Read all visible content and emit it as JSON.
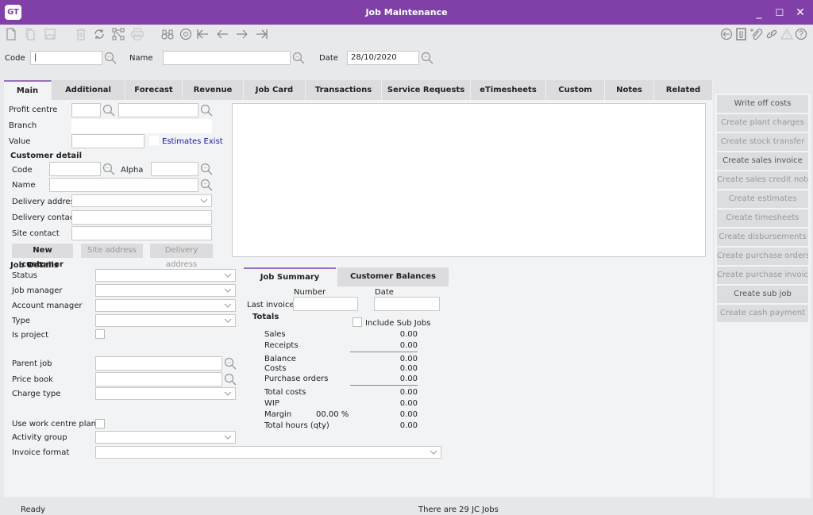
{
  "window": {
    "logo": "GT",
    "title": "Job Maintenance",
    "controls": {
      "minimize": "_",
      "maximize": "☐",
      "close": "✕"
    }
  },
  "toolbar": {
    "left_icons": [
      "new-document-icon",
      "copy-icon",
      "save-icon",
      "delete-icon",
      "refresh-icon",
      "hierarchy-icon",
      "print-icon",
      "binoculars-icon",
      "at-sign-icon",
      "first-record-icon",
      "previous-record-icon",
      "next-record-icon",
      "last-record-icon"
    ],
    "right_icons": [
      "back-icon",
      "attachments-icon",
      "add-attachment-icon",
      "link-icon",
      "warning-icon",
      "help-icon"
    ]
  },
  "header": {
    "code_label": "Code",
    "code_value": "|",
    "name_label": "Name",
    "name_value": "",
    "date_label": "Date",
    "date_value": "28/10/2020"
  },
  "tabs": [
    {
      "label": "Main",
      "active": true
    },
    {
      "label": "Additional"
    },
    {
      "label": "Forecast"
    },
    {
      "label": "Revenue"
    },
    {
      "label": "Job Card"
    },
    {
      "label": "Transactions"
    },
    {
      "label": "Service Requests"
    },
    {
      "label": "eTimesheets"
    },
    {
      "label": "Custom"
    },
    {
      "label": "Notes"
    },
    {
      "label": "Related"
    }
  ],
  "main": {
    "profit_centre_label": "Profit centre",
    "branch_label": "Branch",
    "value_label": "Value",
    "estimates_exist": "Estimates Exist",
    "customer_detail_heading": "Customer detail",
    "customer_code_label": "Code",
    "customer_alpha_label": "Alpha",
    "customer_name_label": "Name",
    "delivery_address_label": "Delivery address",
    "delivery_contact_label": "Delivery contact",
    "site_contact_label": "Site contact",
    "buttons": {
      "new_customer": "New customer",
      "site_address": "Site address",
      "delivery_address": "Delivery address"
    },
    "job_details_heading": "Job Details",
    "status_label": "Status",
    "job_manager_label": "Job manager",
    "account_manager_label": "Account manager",
    "type_label": "Type",
    "is_project_label": "Is project",
    "parent_job_label": "Parent job",
    "price_book_label": "Price book",
    "charge_type_label": "Charge type",
    "use_work_centre_plan_label": "Use work centre plan",
    "activity_group_label": "Activity group",
    "invoice_format_label": "Invoice format"
  },
  "summary": {
    "tabs": [
      {
        "label": "Job Summary",
        "active": true
      },
      {
        "label": "Customer Balances"
      }
    ],
    "number_header": "Number",
    "date_header": "Date",
    "last_invoice_label": "Last invoice",
    "totals_heading": "Totals",
    "include_sub_jobs": "Include Sub Jobs",
    "rows": [
      {
        "label": "Sales",
        "value": "0.00"
      },
      {
        "label": "Receipts",
        "value": "0.00"
      },
      {
        "label": "Balance",
        "value": "0.00"
      },
      {
        "label": "Costs",
        "value": "0.00"
      },
      {
        "label": "Purchase orders",
        "value": "0.00"
      },
      {
        "label": "Total costs",
        "value": "0.00"
      },
      {
        "label": "WIP",
        "value": "0.00"
      },
      {
        "label": "Margin",
        "value": "0.00",
        "pct": "00.00 %"
      },
      {
        "label": "Total hours (qty)",
        "value": "0.00"
      }
    ]
  },
  "side_actions": [
    {
      "label": "Write off costs",
      "enabled": true
    },
    {
      "label": "Create plant charges"
    },
    {
      "label": "Create stock transfer"
    },
    {
      "label": "Create sales invoice",
      "enabled": true
    },
    {
      "label": "Create sales credit note"
    },
    {
      "label": "Create estimates"
    },
    {
      "label": "Create timesheets"
    },
    {
      "label": "Create disbursements"
    },
    {
      "label": "Create purchase orders"
    },
    {
      "label": "Create purchase invoice"
    },
    {
      "label": "Create sub job",
      "enabled": true
    },
    {
      "label": "Create cash payment"
    }
  ],
  "status": {
    "left": "Ready",
    "center": "There are 29 JC Jobs"
  },
  "colors": {
    "brand": "#8040a8",
    "tab_accent": "#9b6fc0",
    "link": "#1a1aa8"
  }
}
